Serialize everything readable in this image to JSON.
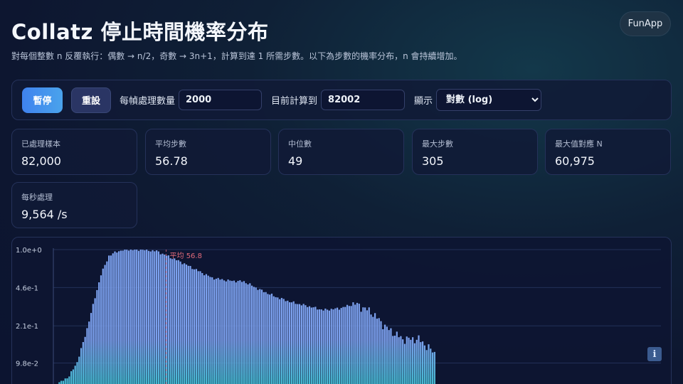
{
  "header": {
    "title": "Collatz 停止時間機率分布",
    "fun_button": "FunApp",
    "subtitle": "對每個整數 n 反覆執行：偶數 → n/2，奇數 → 3n+1，計算到達 1 所需步數。以下為步數的機率分布，n 會持續增加。"
  },
  "controls": {
    "pause_label": "暫停",
    "reset_label": "重設",
    "batch_label": "每幀處理數量",
    "batch_value": "2000",
    "current_label": "目前計算到",
    "current_value": "82002",
    "display_label": "顯示",
    "display_value": "對數 (log)",
    "display_options": [
      "對數 (log)"
    ]
  },
  "stats": [
    {
      "label": "已處理樣本",
      "value": "82,000"
    },
    {
      "label": "平均步數",
      "value": "56.78"
    },
    {
      "label": "中位數",
      "value": "49"
    },
    {
      "label": "最大步數",
      "value": "305"
    },
    {
      "label": "最大值對應 N",
      "value": "60,975"
    },
    {
      "label": "每秒處理",
      "value": "9,564 /s"
    }
  ],
  "info_icon": "info-icon",
  "colors": {
    "accent": "#4a90e2",
    "bar_top": "#7da2f0",
    "bar_bottom": "#2fc6c8",
    "mean_line": "#e06a7a"
  },
  "chart_data": {
    "type": "bar",
    "y_scale": "log",
    "y_ticks": [
      "1.0e+0",
      "4.6e-1",
      "2.1e-1",
      "9.8e-2"
    ],
    "y_tick_values": [
      1.0,
      0.46,
      0.21,
      0.098
    ],
    "ylim": [
      0.045,
      1.0
    ],
    "mean_label": "平均 56.8",
    "mean": 56.8,
    "xlim": [
      0,
      306
    ],
    "grid": true,
    "bins": [
      {
        "x": 0,
        "value": 0.06
      },
      {
        "x": 8,
        "value": 0.075
      },
      {
        "x": 12,
        "value": 0.1
      },
      {
        "x": 16,
        "value": 0.17
      },
      {
        "x": 20,
        "value": 0.32
      },
      {
        "x": 24,
        "value": 0.6
      },
      {
        "x": 28,
        "value": 0.88
      },
      {
        "x": 32,
        "value": 0.96
      },
      {
        "x": 36,
        "value": 1.0
      },
      {
        "x": 44,
        "value": 1.0
      },
      {
        "x": 52,
        "value": 0.97
      },
      {
        "x": 56,
        "value": 0.9
      },
      {
        "x": 64,
        "value": 0.78
      },
      {
        "x": 72,
        "value": 0.66
      },
      {
        "x": 80,
        "value": 0.56
      },
      {
        "x": 88,
        "value": 0.53
      },
      {
        "x": 96,
        "value": 0.52
      },
      {
        "x": 104,
        "value": 0.44
      },
      {
        "x": 112,
        "value": 0.38
      },
      {
        "x": 120,
        "value": 0.34
      },
      {
        "x": 128,
        "value": 0.315
      },
      {
        "x": 136,
        "value": 0.29
      },
      {
        "x": 144,
        "value": 0.3
      },
      {
        "x": 152,
        "value": 0.33
      },
      {
        "x": 160,
        "value": 0.28
      },
      {
        "x": 168,
        "value": 0.2
      },
      {
        "x": 176,
        "value": 0.16
      },
      {
        "x": 184,
        "value": 0.16
      },
      {
        "x": 192,
        "value": 0.12
      },
      {
        "x": 200,
        "value": 0.105
      },
      {
        "x": 208,
        "value": 0.08
      },
      {
        "x": 216,
        "value": 0.07
      },
      {
        "x": 224,
        "value": 0.06
      },
      {
        "x": 240,
        "value": 0.05
      },
      {
        "x": 256,
        "value": 0.045
      },
      {
        "x": 306,
        "value": 0.045
      }
    ]
  }
}
